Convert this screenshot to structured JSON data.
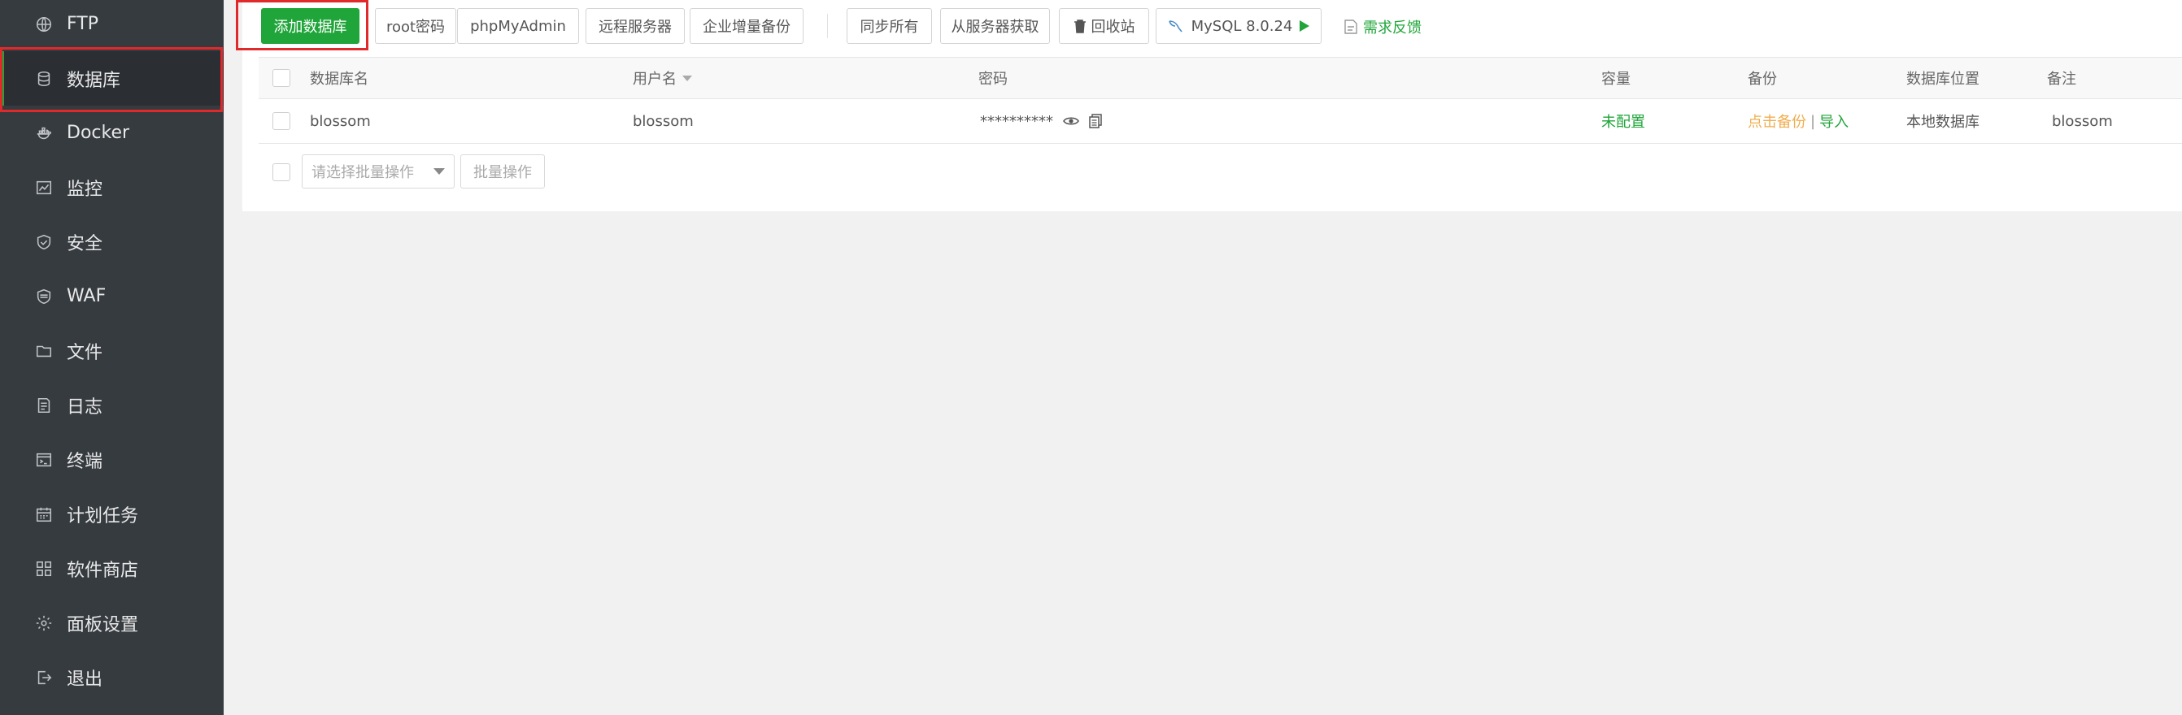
{
  "sidebar": {
    "items": [
      {
        "label": "FTP",
        "icon": "globe-icon"
      },
      {
        "label": "数据库",
        "icon": "database-icon"
      },
      {
        "label": "Docker",
        "icon": "docker-icon"
      },
      {
        "label": "监控",
        "icon": "monitor-chart-icon"
      },
      {
        "label": "安全",
        "icon": "shield-check-icon"
      },
      {
        "label": "WAF",
        "icon": "waf-shield-icon"
      },
      {
        "label": "文件",
        "icon": "folder-icon"
      },
      {
        "label": "日志",
        "icon": "log-document-icon"
      },
      {
        "label": "终端",
        "icon": "terminal-icon"
      },
      {
        "label": "计划任务",
        "icon": "calendar-icon"
      },
      {
        "label": "软件商店",
        "icon": "grid-apps-icon"
      },
      {
        "label": "面板设置",
        "icon": "gear-icon"
      },
      {
        "label": "退出",
        "icon": "logout-icon"
      }
    ],
    "active_index": 1
  },
  "toolbar": {
    "add_database": "添加数据库",
    "root_password": "root密码",
    "phpmyadmin": "phpMyAdmin",
    "remote_server": "远程服务器",
    "incremental_backup": "企业增量备份",
    "sync_all": "同步所有",
    "fetch_from_server": "从服务器获取",
    "recycle_bin": "回收站",
    "mysql_version": "MySQL 8.0.24",
    "feedback": "需求反馈"
  },
  "table": {
    "headers": {
      "name": "数据库名",
      "username": "用户名",
      "password": "密码",
      "capacity": "容量",
      "backup": "备份",
      "location": "数据库位置",
      "remark": "备注"
    },
    "rows": [
      {
        "name": "blossom",
        "username": "blossom",
        "password": "**********",
        "capacity": "未配置",
        "backup_action": "点击备份",
        "separator": "|",
        "import_action": "导入",
        "location": "本地数据库",
        "remark": "blossom"
      }
    ]
  },
  "batch": {
    "select_placeholder": "请选择批量操作",
    "batch_button": "批量操作"
  },
  "colors": {
    "sidebar_bg": "#363b40",
    "accent_green": "#20a53a",
    "backup_orange": "#f0ad4e",
    "highlight_red": "#e0292b"
  }
}
